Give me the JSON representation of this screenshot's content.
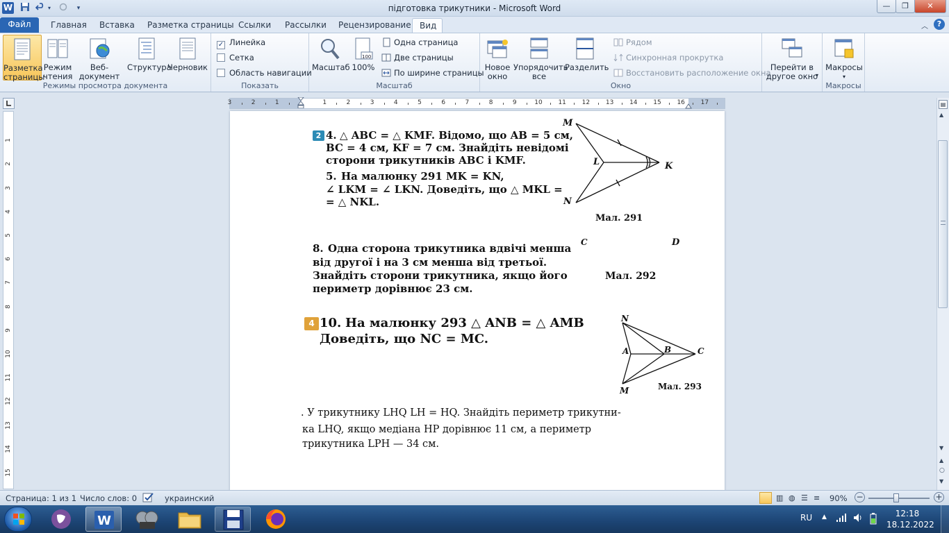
{
  "window": {
    "title": "підготовка трикутники  -  Microsoft Word",
    "app_icon": "W"
  },
  "quick_access": [
    "save-icon",
    "undo-icon",
    "redo-icon",
    "customize-icon"
  ],
  "tabs": [
    {
      "label": "Файл"
    },
    {
      "label": "Главная"
    },
    {
      "label": "Вставка"
    },
    {
      "label": "Разметка страницы"
    },
    {
      "label": "Ссылки"
    },
    {
      "label": "Рассылки"
    },
    {
      "label": "Рецензирование"
    },
    {
      "label": "Вид"
    }
  ],
  "ribbon": {
    "views_group": {
      "label": "Режимы просмотра документа",
      "buttons": [
        {
          "label": "Разметка\nстраницы"
        },
        {
          "label": "Режим\nчтения"
        },
        {
          "label": "Веб-документ"
        },
        {
          "label": "Структура"
        },
        {
          "label": "Черновик"
        }
      ]
    },
    "show_group": {
      "label": "Показать",
      "items": [
        {
          "label": "Линейка",
          "checked": true
        },
        {
          "label": "Сетка",
          "checked": false
        },
        {
          "label": "Область навигации",
          "checked": false
        }
      ]
    },
    "zoom_group": {
      "label": "Масштаб",
      "zoom_label": "Масштаб",
      "hundred_label": "100%",
      "hundred_icon_text": "100",
      "one_page": "Одна страница",
      "two_pages": "Две страницы",
      "page_width": "По ширине страницы"
    },
    "window_group": {
      "label": "Окно",
      "new_window": "Новое\nокно",
      "arrange_all": "Упорядочить\nвсе",
      "split": "Разделить",
      "side_by_side": "Рядом",
      "sync_scroll": "Синхронная прокрутка",
      "reset_position": "Восстановить расположение окна",
      "switch_windows": "Перейти в\nдругое окно"
    },
    "macros_group": {
      "label": "Макросы",
      "macros": "Макросы"
    }
  },
  "ruler": {
    "marks": [
      "3",
      "2",
      "1",
      "1",
      "2",
      "3",
      "4",
      "5",
      "6",
      "7",
      "8",
      "9",
      "10",
      "11",
      "12",
      "13",
      "14",
      "15",
      "16",
      "17"
    ],
    "vmarks": [
      "1",
      "2",
      "3",
      "4",
      "5",
      "6",
      "7",
      "8",
      "9",
      "10",
      "11",
      "12",
      "13",
      "14",
      "15"
    ]
  },
  "document": {
    "p4_badge": "2",
    "p4": {
      "num": "4.",
      "l1": "△ ABC = △ KMF. Відомо, що AB = 5 см,",
      "l2": "BC = 4 см, KF = 7 см. Знайдіть невідомі",
      "l3": "сторони трикутників ABC і KMF."
    },
    "p5": {
      "num": "5.",
      "l1": "На  малюнку  291  MK  =  KN,",
      "l2": "∠ LKM = ∠ LKN. Доведіть, що  △ MKL =",
      "l3": "= △ NKL."
    },
    "fig291": {
      "M": "M",
      "L": "L",
      "K": "K",
      "N": "N",
      "caption": "Мал. 291"
    },
    "p8": {
      "num": "8.",
      "l1": "Одна сторона трикутника вдвічі менша",
      "l2": "від другої і на 3 см менша від третьої.",
      "l3": "Знайдіть сторони трикутника, якщо його",
      "l4": "периметр дорівнює 23 см."
    },
    "fig292": {
      "C": "C",
      "D": "D",
      "caption": "Мал. 292"
    },
    "p10_badge": "4",
    "p10": {
      "num": "10.",
      "l1": "На   малюнку   293   △ ANB   =   △ AMB",
      "l2": "Доведіть, що NC = MC."
    },
    "fig293": {
      "N": "N",
      "A": "A",
      "B": "B",
      "C": "C",
      "M": "M",
      "caption": "Мал. 293"
    },
    "p_last": {
      "l1": ". У трикутнику LHQ  LH = HQ. Знайдіть периметр трикутни-",
      "l2": "ка  LHQ,  якщо  медіана  HP  дорівнює  11 см,  а  периметр",
      "l3": "трикутника LPH — 34 см."
    }
  },
  "status": {
    "page": "Страница: 1 из 1",
    "words": "Число слов: 0",
    "language": "украинский",
    "zoom": "90%",
    "zoom_level_percent": 90
  },
  "taskbar": {
    "lang": "RU",
    "time": "12:18",
    "date": "18.12.2022",
    "apps": [
      "start-orb-icon",
      "viber-icon",
      "word-icon",
      "film-icon",
      "folder-icon",
      "floppy-save-icon",
      "firefox-icon"
    ]
  },
  "colors": {
    "file_tab": "#2a66b4",
    "selected_button": "#f8c65a",
    "taskbar": "#1c4474"
  }
}
